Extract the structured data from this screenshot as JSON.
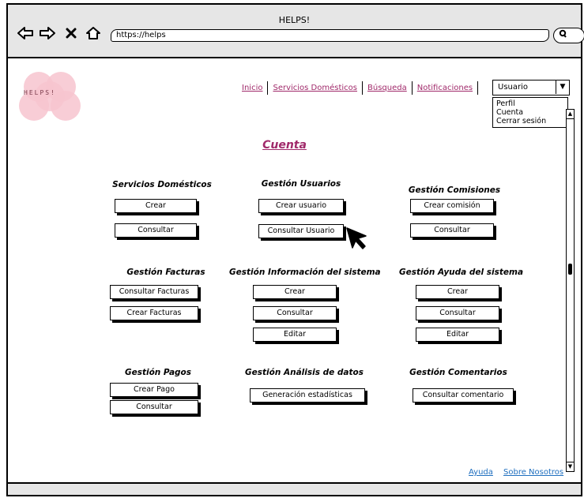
{
  "browser": {
    "title": "HELPS!",
    "url": "https://helps"
  },
  "logo": {
    "text": "HELPS!",
    "brand_color": "#f7c4cf"
  },
  "topnav": {
    "items": [
      "Inicio",
      "Servicios Domésticos",
      "Búsqueda",
      "Notificaciones"
    ],
    "link_color": "#a0296a"
  },
  "user_menu": {
    "selected": "Usuario",
    "options": [
      "Perfil",
      "Cuenta",
      "Cerrar sesión"
    ]
  },
  "page": {
    "title": "Cuenta"
  },
  "sections": {
    "servicios": {
      "heading": "Servicios Domésticos",
      "buttons": [
        "Crear",
        "Consultar"
      ]
    },
    "usuarios": {
      "heading": "Gestión Usuarios",
      "buttons": [
        "Crear usuario",
        "Consultar Usuario"
      ]
    },
    "comisiones": {
      "heading": "Gestión Comisiones",
      "buttons": [
        "Crear comisión",
        "Consultar"
      ]
    },
    "facturas": {
      "heading": "Gestión Facturas",
      "buttons": [
        "Consultar Facturas",
        "Crear Facturas"
      ]
    },
    "informacion": {
      "heading": "Gestión Información del sistema",
      "buttons": [
        "Crear",
        "Consultar",
        "Editar"
      ]
    },
    "ayuda": {
      "heading": "Gestión Ayuda del sistema",
      "buttons": [
        "Crear",
        "Consultar",
        "Editar"
      ]
    },
    "pagos": {
      "heading": "Gestión Pagos",
      "buttons": [
        "Crear Pago",
        "Consultar"
      ]
    },
    "analisis": {
      "heading": "Gestión Análisis de datos",
      "buttons": [
        "Generación estadísticas"
      ]
    },
    "comentarios": {
      "heading": "Gestión Comentarios",
      "buttons": [
        "Consultar comentario"
      ]
    }
  },
  "footer": {
    "links": [
      "Ayuda",
      "Sobre Nosotros"
    ]
  }
}
